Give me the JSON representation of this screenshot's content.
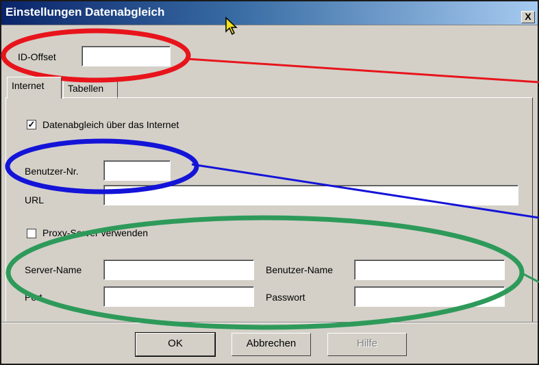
{
  "window": {
    "title": "Einstellungen Datenabgleich",
    "close_glyph": "X"
  },
  "id_offset": {
    "label": "ID-Offset",
    "value": ""
  },
  "tabs": [
    {
      "label": "Internet",
      "active": true
    },
    {
      "label": "Tabellen",
      "active": false
    }
  ],
  "internet": {
    "sync_checkbox": {
      "label": "Datenabgleich über das Internet",
      "checked": true
    },
    "user_no": {
      "label": "Benutzer-Nr.",
      "value": ""
    },
    "url": {
      "label": "URL",
      "value": ""
    },
    "proxy_checkbox": {
      "label": "Proxy-Server verwenden",
      "checked": false
    },
    "server_name": {
      "label": "Server-Name",
      "value": ""
    },
    "port": {
      "label": "Port",
      "value": ""
    },
    "user_name": {
      "label": "Benutzer-Name",
      "value": ""
    },
    "password": {
      "label": "Passwort",
      "value": ""
    }
  },
  "buttons": {
    "ok": "OK",
    "cancel": "Abbrechen",
    "help": "Hilfe"
  },
  "annotation_colors": {
    "id_offset_ellipse": "#e8141c",
    "user_no_ellipse": "#1414d8",
    "proxy_ellipse": "#2e9a5a"
  }
}
